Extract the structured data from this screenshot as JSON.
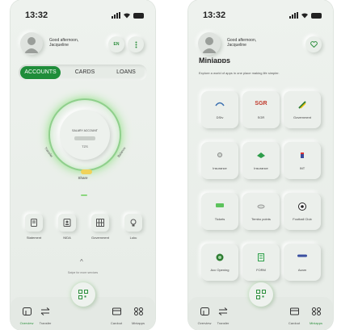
{
  "left_screen": {
    "status": {
      "time": "13:32"
    },
    "header": {
      "greeting_line1": "Good afternoon,",
      "greeting_line2": "Jacqueline",
      "language_button": "EN"
    },
    "tabs": [
      {
        "label": "ACCOUNTS",
        "active": true
      },
      {
        "label": "CARDS",
        "active": false
      },
      {
        "label": "LOANS",
        "active": false
      }
    ],
    "account_dial": {
      "account_label": "SALARY ACCOUNT",
      "currency": "TZS",
      "left_arc_label": "Transfer",
      "right_arc_label": "Balance",
      "bottom_label": "Share"
    },
    "services": [
      {
        "label": "Statement",
        "icon": "statement-icon"
      },
      {
        "label": "NIDA",
        "icon": "id-card-icon"
      },
      {
        "label": "Government",
        "icon": "government-icon"
      },
      {
        "label": "Luku",
        "icon": "bulb-icon"
      }
    ],
    "swipe_hint": "Swipe for more services",
    "nav": [
      {
        "label": "Overview",
        "icon": "overview-icon",
        "active": true
      },
      {
        "label": "Transfer",
        "icon": "transfer-icon",
        "active": false
      },
      {
        "label": "Cardout",
        "icon": "cardout-icon",
        "active": false
      },
      {
        "label": "Miniapps",
        "icon": "miniapps-icon",
        "active": false
      }
    ]
  },
  "right_screen": {
    "status": {
      "time": "13:32"
    },
    "header": {
      "greeting_line1": "Good afternoon,",
      "greeting_line2": "Jacqueline"
    },
    "title": "Miniapps",
    "subtitle": "Explore a world of apps in one place making life simpler.",
    "apps": [
      {
        "label": "DStv",
        "icon": "dstv-icon"
      },
      {
        "label": "SGR",
        "icon": "sgr-icon"
      },
      {
        "label": "Government",
        "icon": "government-icon"
      },
      {
        "label": "Insurance",
        "icon": "insurance-icon"
      },
      {
        "label": "Insurance",
        "icon": "insurance-icon"
      },
      {
        "label": "INT",
        "icon": "int-icon"
      },
      {
        "label": "Tickets",
        "icon": "tickets-icon"
      },
      {
        "label": "Tembo points",
        "icon": "tembo-points-icon"
      },
      {
        "label": "Football Club",
        "icon": "football-icon"
      },
      {
        "label": "Acc Opening",
        "icon": "acc-opening-icon"
      },
      {
        "label": "FORM",
        "icon": "form-icon"
      },
      {
        "label": "Azam",
        "icon": "azam-icon"
      }
    ],
    "nav": [
      {
        "label": "Overview",
        "icon": "overview-icon",
        "active": false
      },
      {
        "label": "Transfer",
        "icon": "transfer-icon",
        "active": false
      },
      {
        "label": "Cardout",
        "icon": "cardout-icon",
        "active": false
      },
      {
        "label": "Miniapps",
        "icon": "miniapps-icon",
        "active": true
      }
    ]
  },
  "colors": {
    "accent": "#1f8d3a",
    "glow": "#8de07f",
    "background": "#eef2ee",
    "share_knob": "#f0d25a"
  }
}
